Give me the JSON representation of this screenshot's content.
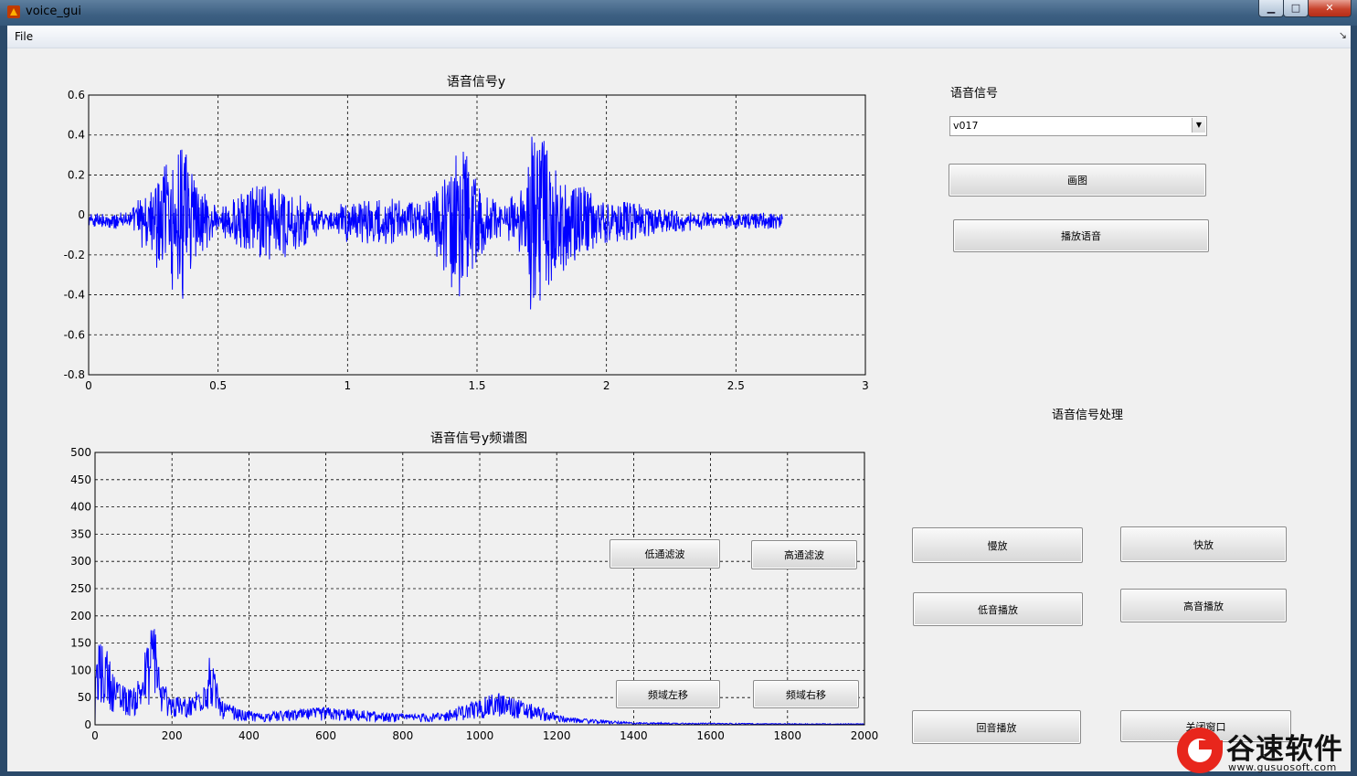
{
  "window": {
    "title": "voice_gui",
    "min_glyph": "▁",
    "max_glyph": "□",
    "close_glyph": "✕"
  },
  "menu": {
    "file": "File",
    "chevron": "↘"
  },
  "right_panel": {
    "signal_label": "语音信号",
    "signal_select_value": "v017",
    "plot_button": "画图",
    "play_button": "播放语音",
    "processing_label": "语音信号处理",
    "slow_button": "慢放",
    "fast_button": "快放",
    "bass_button": "低音播放",
    "treble_button": "高音播放",
    "echo_button": "回音播放",
    "close_window_button": "关闭窗口"
  },
  "filter_buttons": {
    "lowpass": "低通滤波",
    "highpass": "高通滤波",
    "shift_left": "频域左移",
    "shift_right": "频域右移"
  },
  "logo": {
    "text": "谷速软件",
    "url": "www.gusuosoft.com"
  },
  "chart_data": [
    {
      "type": "line",
      "title": "语音信号y",
      "xlim": [
        0,
        3
      ],
      "ylim": [
        -0.8,
        0.6
      ],
      "xticks": [
        "0",
        "0.5",
        "1",
        "1.5",
        "2",
        "2.5",
        "3"
      ],
      "yticks": [
        "0.6",
        "0.4",
        "0.2",
        "0",
        "-0.2",
        "-0.4",
        "-0.6",
        "-0.8"
      ],
      "grid": true,
      "color": "#0000ff",
      "signal_end": 2.68,
      "envelope": [
        [
          0.0,
          0.03
        ],
        [
          0.15,
          0.03
        ],
        [
          0.25,
          0.2
        ],
        [
          0.32,
          0.35
        ],
        [
          0.36,
          0.42
        ],
        [
          0.4,
          0.25
        ],
        [
          0.45,
          0.15
        ],
        [
          0.5,
          0.05
        ],
        [
          0.6,
          0.15
        ],
        [
          0.68,
          0.2
        ],
        [
          0.75,
          0.18
        ],
        [
          0.85,
          0.1
        ],
        [
          0.92,
          0.03
        ],
        [
          1.0,
          0.1
        ],
        [
          1.1,
          0.12
        ],
        [
          1.2,
          0.1
        ],
        [
          1.28,
          0.08
        ],
        [
          1.32,
          0.1
        ],
        [
          1.4,
          0.35
        ],
        [
          1.45,
          0.4
        ],
        [
          1.5,
          0.2
        ],
        [
          1.6,
          0.06
        ],
        [
          1.68,
          0.2
        ],
        [
          1.72,
          0.55
        ],
        [
          1.8,
          0.3
        ],
        [
          1.9,
          0.2
        ],
        [
          1.97,
          0.1
        ],
        [
          2.05,
          0.1
        ],
        [
          2.12,
          0.08
        ],
        [
          2.25,
          0.05
        ],
        [
          2.4,
          0.03
        ],
        [
          2.68,
          0.03
        ]
      ]
    },
    {
      "type": "line",
      "title": "语音信号y频谱图",
      "xlim": [
        0,
        2000
      ],
      "ylim": [
        0,
        500
      ],
      "xticks": [
        "0",
        "200",
        "400",
        "600",
        "800",
        "1000",
        "1200",
        "1400",
        "1600",
        "1800",
        "2000"
      ],
      "yticks": [
        "500",
        "450",
        "400",
        "350",
        "300",
        "250",
        "200",
        "150",
        "100",
        "50",
        "0"
      ],
      "grid": true,
      "color": "#0000ff",
      "peaks": [
        [
          25,
          135
        ],
        [
          60,
          70
        ],
        [
          100,
          60
        ],
        [
          120,
          95
        ],
        [
          145,
          150
        ],
        [
          155,
          205
        ],
        [
          170,
          75
        ],
        [
          210,
          45
        ],
        [
          255,
          50
        ],
        [
          300,
          115
        ],
        [
          330,
          40
        ],
        [
          380,
          25
        ],
        [
          430,
          20
        ],
        [
          600,
          30
        ],
        [
          780,
          18
        ],
        [
          900,
          20
        ],
        [
          1050,
          55
        ],
        [
          1230,
          12
        ],
        [
          1400,
          4
        ],
        [
          1600,
          3
        ],
        [
          1800,
          2
        ],
        [
          2000,
          2
        ]
      ]
    }
  ]
}
